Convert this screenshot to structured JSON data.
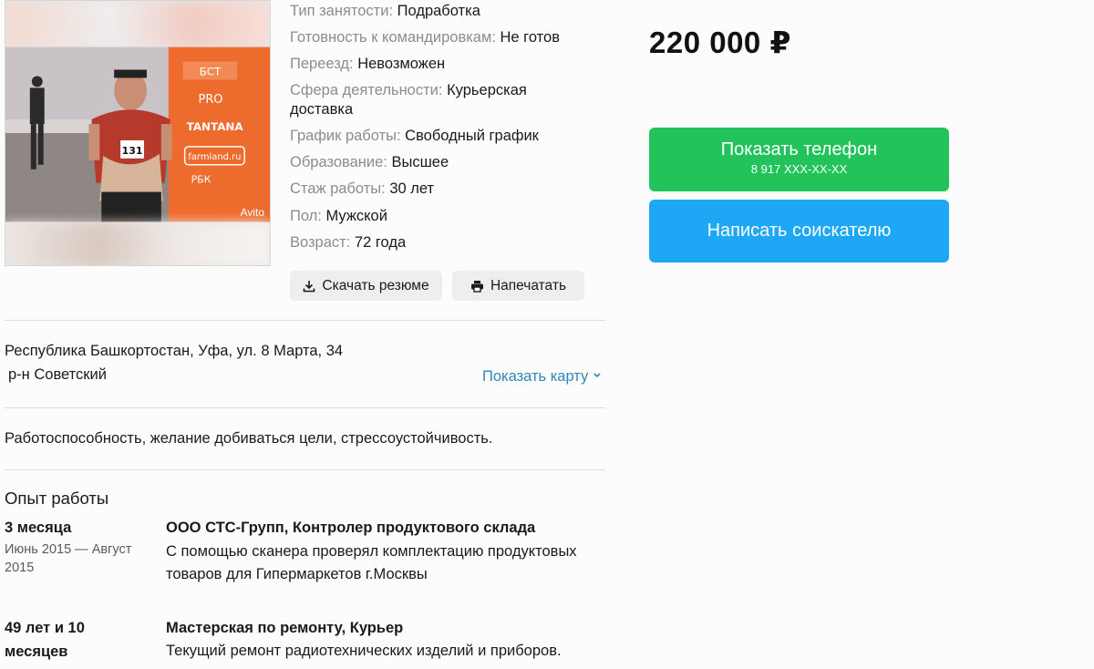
{
  "specs": [
    {
      "key": "Тип занятости:",
      "value": "Подработка"
    },
    {
      "key": "Готовность к командировкам:",
      "value": "Не готов"
    },
    {
      "key": "Переезд:",
      "value": "Невозможен"
    },
    {
      "key": "Сфера деятельности:",
      "value": "Курьерская доставка"
    },
    {
      "key": "График работы:",
      "value": "Свободный график"
    },
    {
      "key": "Образование:",
      "value": "Высшее"
    },
    {
      "key": "Стаж работы:",
      "value": "30 лет"
    },
    {
      "key": "Пол:",
      "value": "Мужской"
    },
    {
      "key": "Возраст:",
      "value": "72 года"
    }
  ],
  "photo": {
    "watermark": "Avito",
    "bib_number": "131",
    "banner_texts": [
      "БСТ",
      "PRO",
      "TANTANA",
      "farmland.ru",
      "РБК"
    ]
  },
  "actions": {
    "download_label": "Скачать резюме",
    "print_label": "Напечатать"
  },
  "price": "220 000 ₽",
  "contact": {
    "phone_label": "Показать телефон",
    "phone_masked": "8 917 XXX-XX-XX",
    "write_label": "Написать соискателю"
  },
  "address": {
    "line1": "Республика Башкортостан, Уфа, ул. 8 Марта, 34",
    "district": "р-н Советский",
    "map_link": "Показать карту"
  },
  "about": "Работоспособность, желание добиваться цели, стрессоустойчивость.",
  "experience": {
    "title": "Опыт работы",
    "items": [
      {
        "duration": "3 месяца",
        "dates": "Июнь 2015 — Август 2015",
        "position": "ООО СТС-Групп, Контролер продуктового склада",
        "description": "С помощью сканера проверял комплектацию продуктовых товаров для Гипермаркетов г.Москвы"
      },
      {
        "duration": "49 лет и 10 месяцев",
        "position": "Мастерская по ремонту, Курьер",
        "description": "Текущий ремонт радиотехнических изделий и приборов."
      }
    ]
  },
  "colors": {
    "green": "#22c35a",
    "blue": "#1ea7f4",
    "link": "#2f87b8"
  }
}
